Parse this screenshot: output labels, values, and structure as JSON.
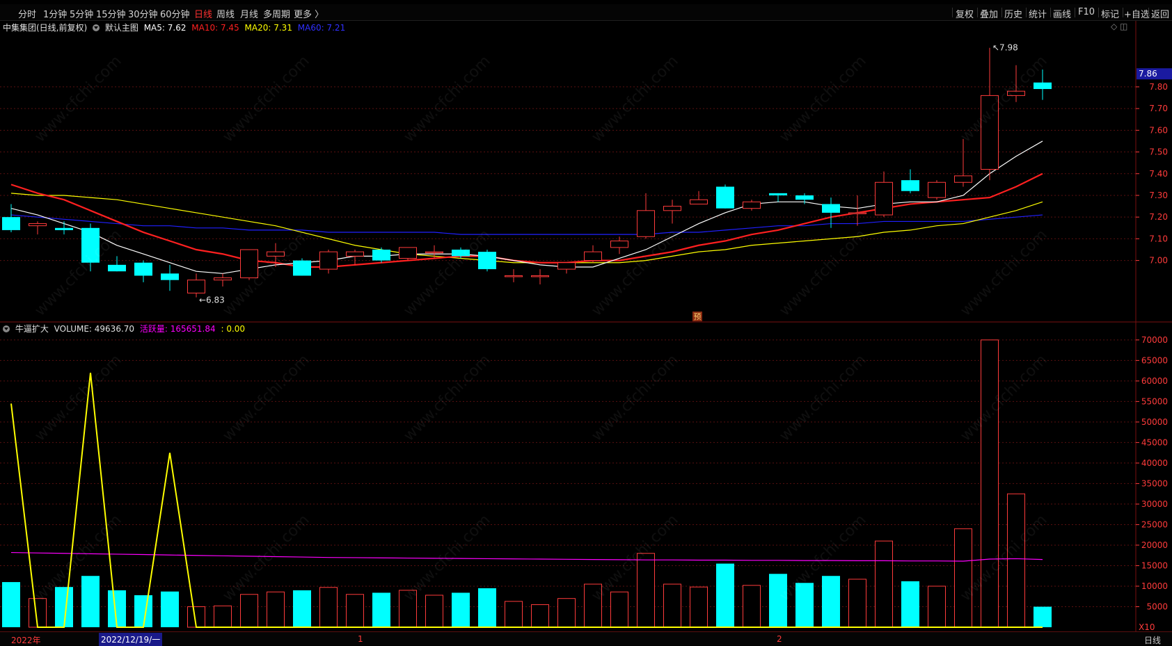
{
  "toolbar": {
    "timeframes": [
      "分时",
      "1分钟",
      "5分钟",
      "15分钟",
      "30分钟",
      "60分钟",
      "日线",
      "周线",
      "月线",
      "多周期",
      "更多 〉"
    ],
    "active_timeframe": "日线",
    "right_buttons": [
      "复权",
      "叠加",
      "历史",
      "统计",
      "画线",
      "F10",
      "标记",
      "+自选",
      "返回"
    ]
  },
  "main_legend": {
    "title": "中集集团(日线,前复权)",
    "template": "默认主图",
    "ma": [
      {
        "label": "MA5: 7.62",
        "color": "#ffffff"
      },
      {
        "label": "MA10: 7.45",
        "color": "#ff2020"
      },
      {
        "label": "MA20: 7.31",
        "color": "#ffff00"
      },
      {
        "label": "MA60: 7.21",
        "color": "#2020ff"
      }
    ]
  },
  "vol_legend": {
    "title": "牛逼扩大",
    "items": [
      {
        "label": "VOLUME: 49636.70",
        "color": "#c8c8c8"
      },
      {
        "label": "活跃量: 165651.84",
        "color": "#ff00ff"
      },
      {
        "label": ": 0.00",
        "color": "#ffff00"
      }
    ]
  },
  "colors": {
    "up": "#ff3b3b",
    "down": "#00ffff",
    "ma5": "#ffffff",
    "ma10": "#ff2020",
    "ma20": "#ffff00",
    "ma60": "#2020ff",
    "active_vol": "#ff00ff",
    "signal": "#ffff00",
    "axis": "#ff3b3b"
  },
  "chart_data": [
    {
      "type": "candlestick",
      "title": "中集集团(日线,前复权)",
      "ylim": [
        6.72,
        8.04
      ],
      "y_ticks": [
        7.0,
        7.1,
        7.2,
        7.3,
        7.4,
        7.5,
        7.6,
        7.7,
        7.8
      ],
      "current_price": "7.86",
      "annotations": [
        {
          "text": "7.98",
          "value": 7.98,
          "index": 37
        },
        {
          "text": "6.83",
          "value": 6.83,
          "index": 7
        }
      ],
      "marker": "预",
      "x_labels": [
        "2022年",
        "2022/12/19/一",
        "1",
        "2"
      ],
      "candles": [
        {
          "o": 7.2,
          "h": 7.26,
          "l": 7.13,
          "c": 7.14
        },
        {
          "o": 7.16,
          "h": 7.18,
          "l": 7.12,
          "c": 7.17
        },
        {
          "o": 7.15,
          "h": 7.18,
          "l": 7.12,
          "c": 7.14
        },
        {
          "o": 7.15,
          "h": 7.17,
          "l": 6.95,
          "c": 6.99
        },
        {
          "o": 6.98,
          "h": 7.02,
          "l": 6.95,
          "c": 6.95
        },
        {
          "o": 6.99,
          "h": 7.0,
          "l": 6.9,
          "c": 6.93
        },
        {
          "o": 6.94,
          "h": 6.98,
          "l": 6.86,
          "c": 6.91
        },
        {
          "o": 6.85,
          "h": 6.94,
          "l": 6.83,
          "c": 6.91
        },
        {
          "o": 6.91,
          "h": 6.94,
          "l": 6.88,
          "c": 6.92
        },
        {
          "o": 6.92,
          "h": 7.05,
          "l": 6.91,
          "c": 7.05
        },
        {
          "o": 7.02,
          "h": 7.08,
          "l": 6.97,
          "c": 7.04
        },
        {
          "o": 7.0,
          "h": 7.01,
          "l": 6.93,
          "c": 6.93
        },
        {
          "o": 6.96,
          "h": 7.05,
          "l": 6.94,
          "c": 7.04
        },
        {
          "o": 7.02,
          "h": 7.05,
          "l": 6.98,
          "c": 7.04
        },
        {
          "o": 7.05,
          "h": 7.06,
          "l": 6.99,
          "c": 7.0
        },
        {
          "o": 7.01,
          "h": 7.06,
          "l": 7.0,
          "c": 7.06
        },
        {
          "o": 7.04,
          "h": 7.07,
          "l": 7.01,
          "c": 7.04
        },
        {
          "o": 7.05,
          "h": 7.06,
          "l": 7.01,
          "c": 7.02
        },
        {
          "o": 7.04,
          "h": 7.05,
          "l": 6.95,
          "c": 6.96
        },
        {
          "o": 6.93,
          "h": 6.96,
          "l": 6.9,
          "c": 6.93
        },
        {
          "o": 6.93,
          "h": 6.96,
          "l": 6.89,
          "c": 6.93
        },
        {
          "o": 6.96,
          "h": 6.99,
          "l": 6.94,
          "c": 6.99
        },
        {
          "o": 7.0,
          "h": 7.07,
          "l": 6.99,
          "c": 7.04
        },
        {
          "o": 7.06,
          "h": 7.11,
          "l": 7.03,
          "c": 7.09
        },
        {
          "o": 7.11,
          "h": 7.31,
          "l": 7.1,
          "c": 7.23
        },
        {
          "o": 7.23,
          "h": 7.28,
          "l": 7.17,
          "c": 7.25
        },
        {
          "o": 7.26,
          "h": 7.32,
          "l": 7.26,
          "c": 7.28
        },
        {
          "o": 7.34,
          "h": 7.35,
          "l": 7.24,
          "c": 7.24
        },
        {
          "o": 7.24,
          "h": 7.28,
          "l": 7.23,
          "c": 7.27
        },
        {
          "o": 7.31,
          "h": 7.31,
          "l": 7.27,
          "c": 7.3
        },
        {
          "o": 7.3,
          "h": 7.31,
          "l": 7.26,
          "c": 7.28
        },
        {
          "o": 7.26,
          "h": 7.29,
          "l": 7.15,
          "c": 7.22
        },
        {
          "o": 7.22,
          "h": 7.3,
          "l": 7.16,
          "c": 7.22
        },
        {
          "o": 7.21,
          "h": 7.41,
          "l": 7.2,
          "c": 7.36
        },
        {
          "o": 7.37,
          "h": 7.42,
          "l": 7.31,
          "c": 7.32
        },
        {
          "o": 7.29,
          "h": 7.37,
          "l": 7.28,
          "c": 7.36
        },
        {
          "o": 7.36,
          "h": 7.56,
          "l": 7.34,
          "c": 7.39
        },
        {
          "o": 7.42,
          "h": 7.98,
          "l": 7.37,
          "c": 7.76
        },
        {
          "o": 7.76,
          "h": 7.9,
          "l": 7.73,
          "c": 7.78
        },
        {
          "o": 7.82,
          "h": 7.88,
          "l": 7.74,
          "c": 7.79
        }
      ],
      "ma5": [
        7.24,
        7.21,
        7.17,
        7.13,
        7.07,
        7.03,
        6.99,
        6.95,
        6.94,
        6.96,
        6.98,
        6.99,
        7.0,
        7.02,
        7.02,
        7.03,
        7.03,
        7.03,
        7.02,
        7.0,
        6.98,
        6.97,
        6.97,
        7.01,
        7.05,
        7.11,
        7.17,
        7.22,
        7.26,
        7.27,
        7.27,
        7.25,
        7.24,
        7.26,
        7.27,
        7.27,
        7.3,
        7.4,
        7.48,
        7.55
      ],
      "ma10": [
        7.35,
        7.31,
        7.28,
        7.23,
        7.18,
        7.13,
        7.09,
        7.05,
        7.03,
        7.0,
        6.99,
        6.97,
        6.97,
        6.98,
        6.99,
        7.0,
        7.01,
        7.02,
        7.02,
        7.0,
        6.99,
        6.99,
        7.0,
        7.0,
        7.02,
        7.04,
        7.07,
        7.09,
        7.12,
        7.14,
        7.17,
        7.2,
        7.22,
        7.24,
        7.26,
        7.27,
        7.28,
        7.29,
        7.34,
        7.4
      ],
      "ma20": [
        7.31,
        7.3,
        7.3,
        7.29,
        7.28,
        7.26,
        7.24,
        7.22,
        7.2,
        7.18,
        7.16,
        7.13,
        7.1,
        7.07,
        7.05,
        7.03,
        7.02,
        7.01,
        7.0,
        6.99,
        6.99,
        6.99,
        6.99,
        6.99,
        7.0,
        7.02,
        7.04,
        7.05,
        7.07,
        7.08,
        7.09,
        7.1,
        7.11,
        7.13,
        7.14,
        7.16,
        7.17,
        7.2,
        7.23,
        7.27
      ],
      "ma60": [
        7.21,
        7.2,
        7.19,
        7.18,
        7.17,
        7.16,
        7.16,
        7.15,
        7.15,
        7.14,
        7.14,
        7.14,
        7.13,
        7.13,
        7.13,
        7.13,
        7.13,
        7.12,
        7.12,
        7.12,
        7.12,
        7.12,
        7.12,
        7.12,
        7.12,
        7.13,
        7.13,
        7.14,
        7.15,
        7.16,
        7.16,
        7.17,
        7.17,
        7.18,
        7.18,
        7.18,
        7.18,
        7.19,
        7.2,
        7.21
      ]
    },
    {
      "type": "bar",
      "title": "牛逼扩大",
      "ylim": [
        0,
        71500
      ],
      "y_ticks": [
        5000,
        10000,
        15000,
        20000,
        25000,
        30000,
        35000,
        40000,
        45000,
        50000,
        55000,
        60000,
        65000,
        70000
      ],
      "unit_label": "X10",
      "volume": [
        11000,
        7000,
        9800,
        12500,
        9000,
        7800,
        8700,
        5000,
        5200,
        8000,
        8600,
        9000,
        9700,
        8000,
        8400,
        9000,
        7800,
        8400,
        9500,
        6300,
        5500,
        7000,
        10500,
        8600,
        18000,
        10500,
        9800,
        15500,
        10200,
        13000,
        10800,
        12500,
        11700,
        21000,
        11200,
        10000,
        24000,
        70000,
        32500,
        5000
      ],
      "active_volume": [
        18200,
        18100,
        18000,
        17900,
        17800,
        17700,
        17600,
        17500,
        17400,
        17300,
        17200,
        17100,
        17000,
        16950,
        16900,
        16850,
        16800,
        16750,
        16700,
        16650,
        16600,
        16550,
        16500,
        16450,
        16400,
        16400,
        16350,
        16350,
        16300,
        16300,
        16250,
        16250,
        16200,
        16200,
        16150,
        16150,
        16100,
        16600,
        16700,
        16500
      ],
      "signal": [
        54500,
        0,
        0,
        62000,
        0,
        0,
        42500,
        0,
        0,
        0,
        0,
        0,
        0,
        0,
        0,
        0,
        0,
        0,
        0,
        0,
        0,
        0,
        0,
        0,
        0,
        0,
        0,
        0,
        0,
        0,
        0,
        0,
        0,
        0,
        0,
        0,
        0,
        0,
        0,
        0
      ]
    }
  ]
}
